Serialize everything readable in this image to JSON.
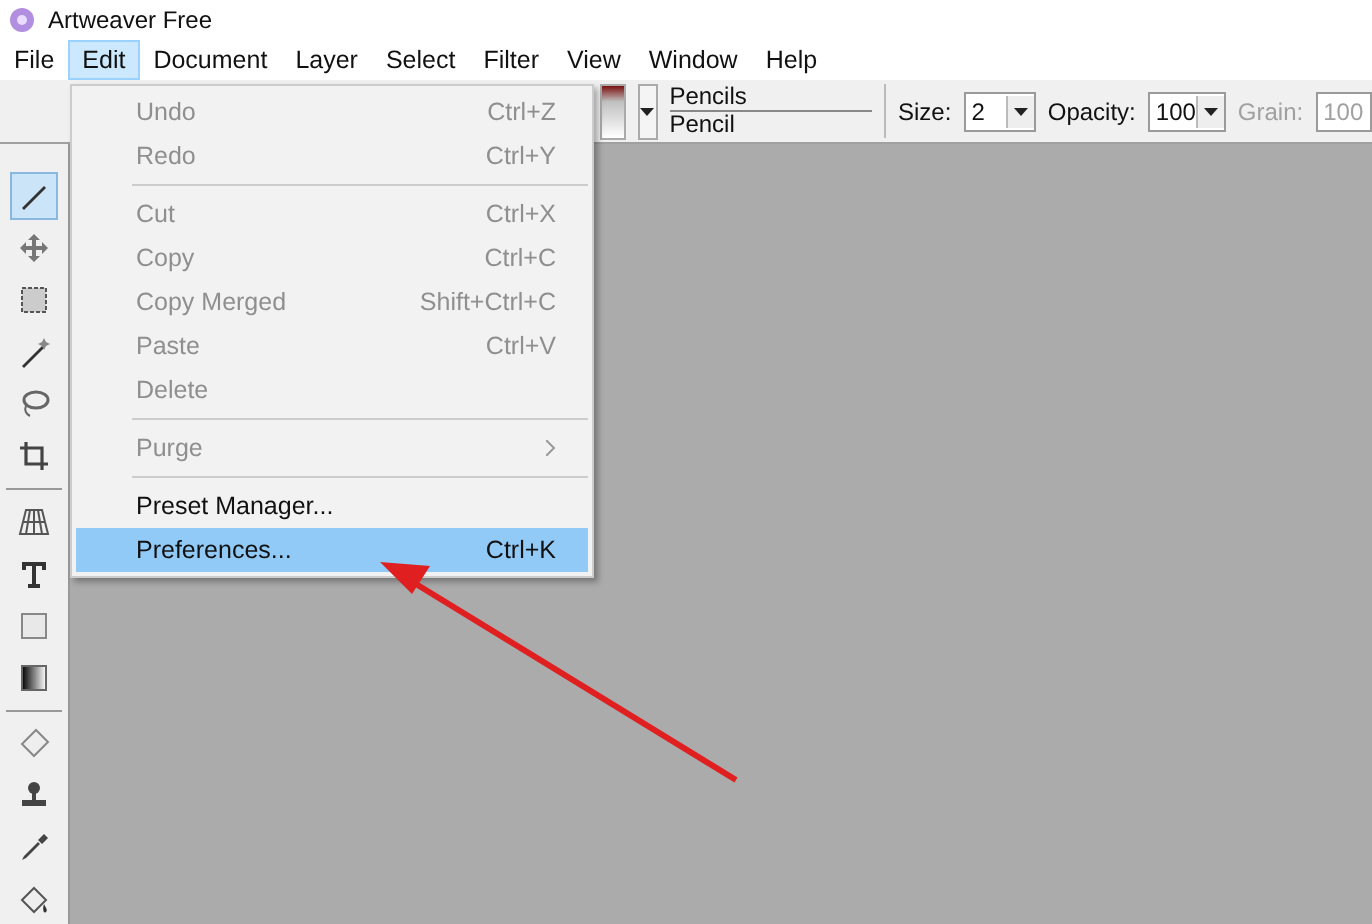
{
  "window": {
    "title": "Artweaver Free"
  },
  "menu_bar": [
    {
      "label": "File",
      "selected": false
    },
    {
      "label": "Edit",
      "selected": true
    },
    {
      "label": "Document",
      "selected": false
    },
    {
      "label": "Layer",
      "selected": false
    },
    {
      "label": "Select",
      "selected": false
    },
    {
      "label": "Filter",
      "selected": false
    },
    {
      "label": "View",
      "selected": false
    },
    {
      "label": "Window",
      "selected": false
    },
    {
      "label": "Help",
      "selected": false
    }
  ],
  "edit_menu": [
    {
      "kind": "item",
      "label": "Undo",
      "shortcut": "Ctrl+Z",
      "disabled": true,
      "selected": false
    },
    {
      "kind": "item",
      "label": "Redo",
      "shortcut": "Ctrl+Y",
      "disabled": true,
      "selected": false
    },
    {
      "kind": "separator"
    },
    {
      "kind": "item",
      "label": "Cut",
      "shortcut": "Ctrl+X",
      "disabled": true,
      "selected": false
    },
    {
      "kind": "item",
      "label": "Copy",
      "shortcut": "Ctrl+C",
      "disabled": true,
      "selected": false
    },
    {
      "kind": "item",
      "label": "Copy Merged",
      "shortcut": "Shift+Ctrl+C",
      "disabled": true,
      "selected": false
    },
    {
      "kind": "item",
      "label": "Paste",
      "shortcut": "Ctrl+V",
      "disabled": true,
      "selected": false
    },
    {
      "kind": "item",
      "label": "Delete",
      "disabled": true,
      "selected": false
    },
    {
      "kind": "separator"
    },
    {
      "kind": "submenu",
      "label": "Purge",
      "disabled": true,
      "selected": false
    },
    {
      "kind": "separator"
    },
    {
      "kind": "item",
      "label": "Preset Manager...",
      "disabled": false,
      "selected": false
    },
    {
      "kind": "item",
      "label": "Preferences...",
      "shortcut": "Ctrl+K",
      "disabled": false,
      "selected": true
    }
  ],
  "options_bar": {
    "preset_category": "Pencils",
    "preset": "Pencil",
    "size_label": "Size:",
    "size": "2",
    "opacity_label": "Opacity:",
    "opacity": "100",
    "grain_label": "Grain:",
    "grain": "100"
  },
  "tools": [
    {
      "kind": "brush",
      "selected": true
    },
    {
      "kind": "move",
      "selected": false
    },
    {
      "kind": "marquee",
      "selected": false
    },
    {
      "kind": "wand",
      "selected": false
    },
    {
      "kind": "lasso",
      "selected": false
    },
    {
      "kind": "crop",
      "selected": false
    },
    {
      "kind": "separator"
    },
    {
      "kind": "grid",
      "selected": false
    },
    {
      "kind": "text",
      "selected": false
    },
    {
      "kind": "shape",
      "selected": false
    },
    {
      "kind": "gradient",
      "selected": false
    },
    {
      "kind": "separator"
    },
    {
      "kind": "eraser",
      "selected": false
    },
    {
      "kind": "stamp",
      "selected": false
    },
    {
      "kind": "dropper",
      "selected": false
    },
    {
      "kind": "bucket",
      "selected": false
    }
  ]
}
